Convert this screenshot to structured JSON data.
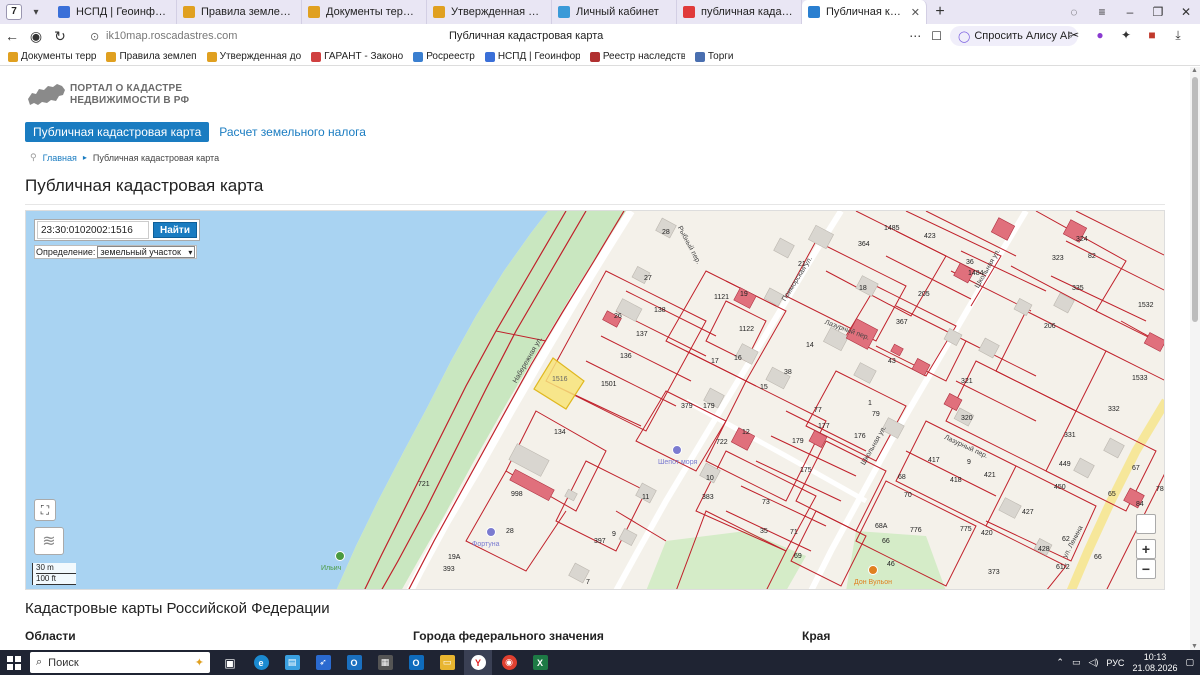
{
  "browser": {
    "tab_counter": "7",
    "tabs": [
      {
        "label": "НСПД | Геоинформацио",
        "favicon_color": "#3a6fd8"
      },
      {
        "label": "Правила землепользов",
        "favicon_color": "#e0a020"
      },
      {
        "label": "Документы территориал",
        "favicon_color": "#e0a020"
      },
      {
        "label": "Утвержденная документ",
        "favicon_color": "#e0a020"
      },
      {
        "label": "Личный кабинет",
        "favicon_color": "#3a9ad8"
      },
      {
        "label": "публичная кадастровая к",
        "favicon_color": "#e03a3a"
      },
      {
        "label": "Публичная кадастровая",
        "favicon_color": "#2a7fd0",
        "active": true,
        "close": "✕"
      }
    ],
    "url_domain": "ik10map.roscadastres.com",
    "page_title": "Публичная кадастровая карта",
    "alice_button": "Спросить Алису AI",
    "bookmarks": [
      {
        "label": "Документы терр",
        "color": "#e0a020"
      },
      {
        "label": "Правила землеп",
        "color": "#e0a020"
      },
      {
        "label": "Утвержденная до",
        "color": "#e0a020"
      },
      {
        "label": "ГАРАНТ - Законо",
        "color": "#d04040"
      },
      {
        "label": "Росреестр",
        "color": "#3a7fd0"
      },
      {
        "label": "НСПД | Геоинфор",
        "color": "#3a6fd8"
      },
      {
        "label": "Реестр наследств",
        "color": "#b03030"
      },
      {
        "label": "Торги",
        "color": "#4a6fb0"
      }
    ]
  },
  "site": {
    "logo_line1": "ПОРТАЛ О КАДАСТРЕ",
    "logo_line2": "НЕДВИЖИМОСТИ В РФ",
    "nav_active": "Публичная кадастровая карта",
    "nav_link": "Расчет земельного налога",
    "breadcrumb_home": "Главная",
    "breadcrumb_current": "Публичная кадастровая карта",
    "heading": "Публичная кадастровая карта",
    "section_title": "Кадастровые карты Российской Федерации",
    "columns": [
      "Области",
      "Города федерального значения",
      "Края"
    ]
  },
  "map": {
    "search_value": "23:30:0102002:1516",
    "search_button": "Найти",
    "definition_label": "Определение:",
    "definition_value": "земельный участок",
    "scale_m": "30 m",
    "scale_ft": "100 ft",
    "zoom_in": "+",
    "zoom_out": "−",
    "selected_parcel": "1516",
    "streets": [
      "Набережная ул.",
      "Рыбный пер.",
      "Приморская ул.",
      "Лазурный пер.",
      "Школьная ул.",
      "Лазурный пер.",
      "Школьная ул.",
      "ул. Ленина"
    ],
    "pois": [
      "Шепот моря",
      "Фортуна",
      "Дон Вульон",
      "Ильич"
    ],
    "labels": [
      "28",
      "27",
      "26",
      "138",
      "137",
      "136",
      "1501",
      "134",
      "1121",
      "19",
      "1122",
      "21",
      "18",
      "364",
      "1485",
      "423",
      "36",
      "324",
      "82",
      "323",
      "335",
      "1532",
      "206",
      "205",
      "367",
      "17",
      "16",
      "38",
      "14",
      "15",
      "379",
      "179",
      "77",
      "177",
      "179",
      "176",
      "175",
      "73",
      "71",
      "35",
      "69",
      "722",
      "12",
      "383",
      "10",
      "11",
      "397",
      "9",
      "28",
      "19A",
      "393",
      "7",
      "721",
      "998",
      "1",
      "79",
      "43",
      "321",
      "320",
      "417",
      "418",
      "421",
      "70",
      "68",
      "776",
      "775",
      "420",
      "428",
      "427",
      "449",
      "450",
      "331",
      "332",
      "1533",
      "67",
      "65",
      "66",
      "62",
      "61/2",
      "373",
      "46",
      "68A",
      "66",
      "78",
      "9",
      "84",
      "1484"
    ]
  },
  "taskbar": {
    "search_placeholder": "Поиск",
    "lang": "РУС",
    "time": "10:13",
    "date": "21.08.2026"
  }
}
